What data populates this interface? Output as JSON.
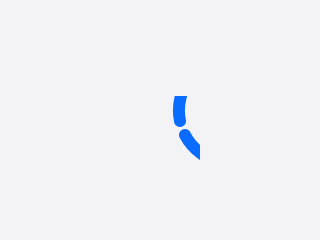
{
  "screen": {
    "background_color": "#f3f3f6"
  },
  "loading_indicator": {
    "icon": "loading-spinner-icon",
    "color": "#0a6cff"
  }
}
